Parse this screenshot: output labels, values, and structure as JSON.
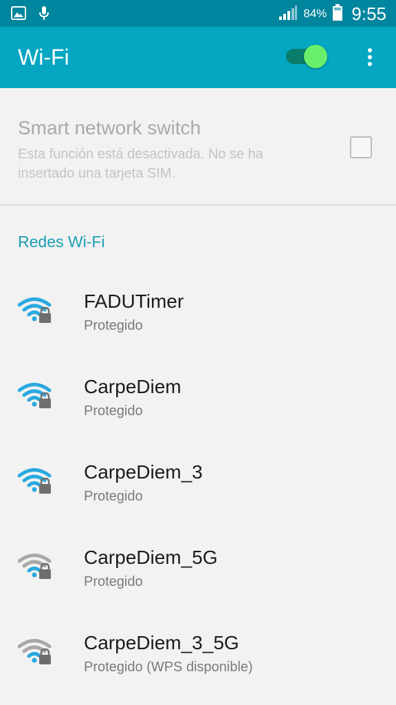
{
  "status_bar": {
    "battery_percent": "84%",
    "time": "9:55",
    "icons": [
      "image-icon",
      "microphone-icon",
      "cell-signal-icon",
      "battery-icon"
    ]
  },
  "app_bar": {
    "title": "Wi-Fi",
    "wifi_enabled": true,
    "accent_color": "#04a6c2"
  },
  "smart_network": {
    "title": "Smart network switch",
    "description": "Esta función está desactivada. No se ha insertado una tarjeta SIM.",
    "checked": false
  },
  "section_header": "Redes Wi-Fi",
  "networks": [
    {
      "ssid": "FADUTimer",
      "security": "Protegido",
      "icon": "wifi-locked-strong-icon",
      "strength": "strong"
    },
    {
      "ssid": "CarpeDiem",
      "security": "Protegido",
      "icon": "wifi-locked-strong-icon",
      "strength": "strong"
    },
    {
      "ssid": "CarpeDiem_3",
      "security": "Protegido",
      "icon": "wifi-locked-strong-icon",
      "strength": "strong"
    },
    {
      "ssid": "CarpeDiem_5G",
      "security": "Protegido",
      "icon": "wifi-locked-weak-icon",
      "strength": "weak"
    },
    {
      "ssid": "CarpeDiem_3_5G",
      "security": "Protegido (WPS disponible)",
      "icon": "wifi-locked-weak-icon",
      "strength": "weak"
    }
  ],
  "colors": {
    "status_bar": "#00859e",
    "app_bar": "#04a6c2",
    "toggle_on": "#69ef6b",
    "wifi_strong": "#29a9e1",
    "wifi_weak": "#a8a8a8"
  }
}
